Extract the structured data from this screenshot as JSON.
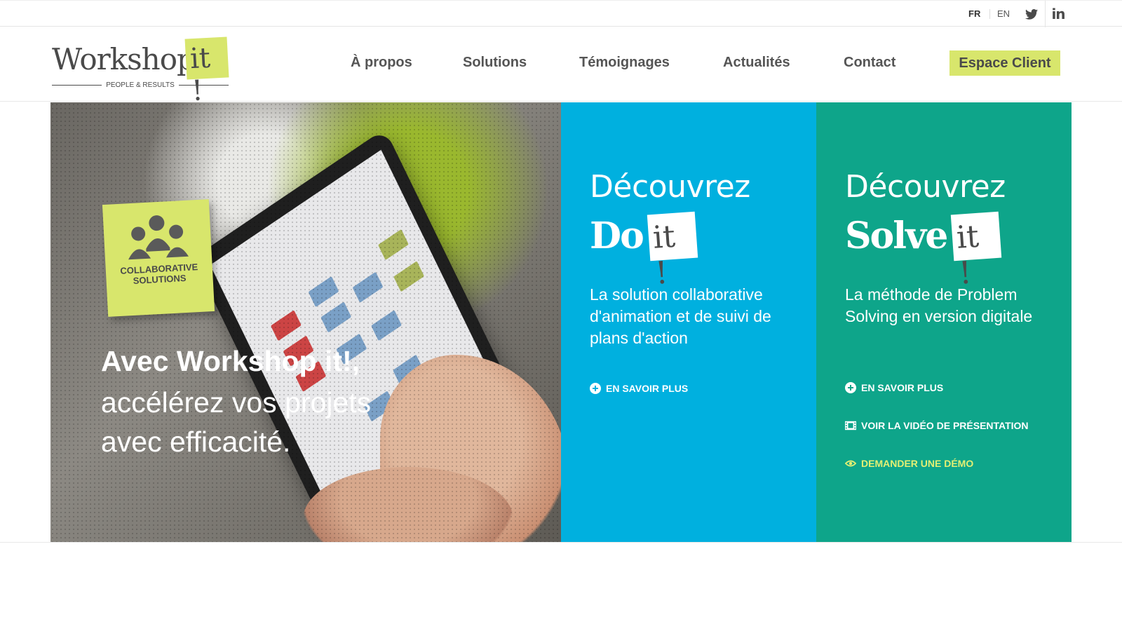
{
  "topbar": {
    "lang_fr": "FR",
    "lang_en": "EN",
    "social": [
      "twitter-icon",
      "linkedin-icon"
    ],
    "linkedin_glyph": "in"
  },
  "header": {
    "logo": {
      "word": "Workshop",
      "it": "it !",
      "tagline": "PEOPLE & RESULTS"
    },
    "nav": [
      "À propos",
      "Solutions",
      "Témoignages",
      "Actualités",
      "Contact"
    ],
    "cta": "Espace Client"
  },
  "colors": {
    "accent_yellow": "#d8e66c",
    "blue_panel": "#00b0df",
    "green_panel": "#0ea58a",
    "link_yellow": "#e3ef73"
  },
  "hero": {
    "sticky": {
      "line1": "COLLABORATIVE",
      "line2": "SOLUTIONS"
    },
    "headline": "Avec Workshop it!,",
    "subline": "accélérez vos projets avec efficacité."
  },
  "panels": {
    "doit": {
      "title": "Découvrez",
      "brand_word": "Do",
      "brand_it": "it !",
      "description": "La solution collaborative d'animation et de suivi de plans d'action",
      "link": "EN SAVOIR PLUS"
    },
    "solveit": {
      "title": "Découvrez",
      "brand_word": "Solve",
      "brand_it": "it !",
      "description": "La méthode de Problem Solving en version digitale",
      "link_more": "EN SAVOIR PLUS",
      "link_video": "VOIR LA VIDÉO DE PRÉSENTATION",
      "link_demo": "DEMANDER UNE DÉMO"
    }
  }
}
